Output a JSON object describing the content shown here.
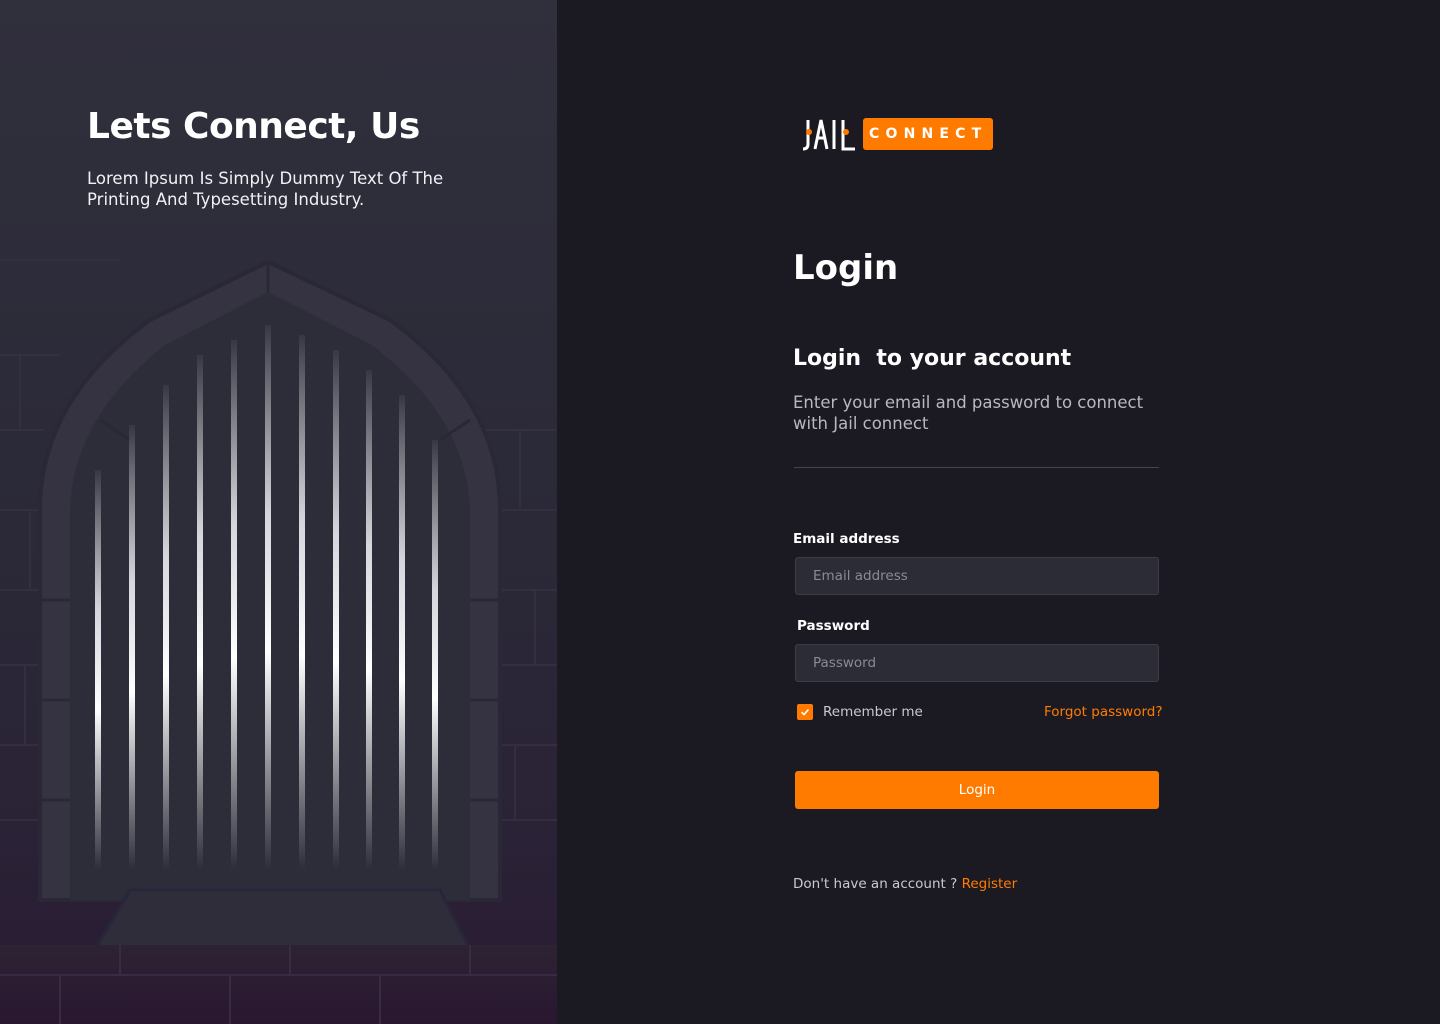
{
  "hero": {
    "title": "Lets Connect, Us",
    "subtitle": "Lorem Ipsum Is Simply Dummy Text Of The Printing And Typesetting Industry."
  },
  "brand": {
    "wordmark": "JAIL",
    "badge": "CONNECT",
    "accent_color": "#ff7b00"
  },
  "login": {
    "heading": "Login",
    "subheading": "Login  to your account",
    "description": "Enter your email and password to connect with Jail connect"
  },
  "form": {
    "email_label": "Email address",
    "email_placeholder": "Email address",
    "password_label": "Password",
    "password_placeholder": "Password",
    "remember_label": "Remember me",
    "remember_checked": true,
    "forgot_label": "Forgot password?",
    "submit_label": "Login"
  },
  "footer": {
    "prompt": "Don't have an account ?",
    "register_label": "Register"
  },
  "colors": {
    "accent": "#ff7b00",
    "panel_bg": "#1b1a22",
    "input_bg": "#2c2c36"
  },
  "icons": {
    "checkbox": "check-icon",
    "hero_art": "prison-gate-illustration"
  }
}
